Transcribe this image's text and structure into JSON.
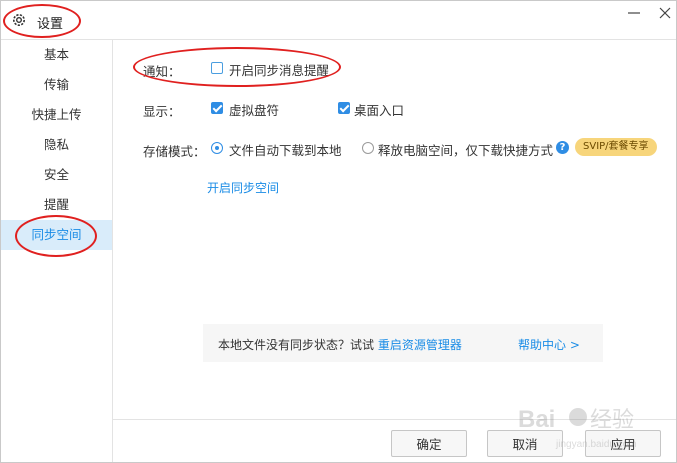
{
  "window": {
    "title": "设置",
    "icons": {
      "settings": "gear-icon",
      "minimize": "minimize-icon",
      "close": "close-icon"
    }
  },
  "sidebar": {
    "items": [
      {
        "label": "基本",
        "active": false
      },
      {
        "label": "传输",
        "active": false
      },
      {
        "label": "快捷上传",
        "active": false
      },
      {
        "label": "隐私",
        "active": false
      },
      {
        "label": "安全",
        "active": false
      },
      {
        "label": "提醒",
        "active": false
      },
      {
        "label": "同步空间",
        "active": true
      }
    ]
  },
  "notify": {
    "label": "通知：",
    "option": "开启同步消息提醒",
    "checked": false
  },
  "display": {
    "label": "显示：",
    "options": [
      {
        "label": "虚拟盘符",
        "checked": true
      },
      {
        "label": "桌面入口",
        "checked": true
      }
    ]
  },
  "storage": {
    "label": "存储模式：",
    "options": [
      {
        "label": "文件自动下载到本地",
        "selected": true
      },
      {
        "label": "释放电脑空间，仅下载快捷方式",
        "selected": false
      }
    ],
    "help_icon": "question-icon",
    "badge": "SVIP/套餐专享"
  },
  "enable_sync_link": "开启同步空间",
  "tip": {
    "text": "本地文件没有同步状态？试试",
    "restart_link": "重启资源管理器",
    "help_link": "帮助中心 >"
  },
  "buttons": {
    "ok": "确定",
    "cancel": "取消",
    "apply": "应用"
  },
  "watermark": {
    "text": "Baidu经验",
    "sub": "jingyan.baidu.com"
  },
  "colors": {
    "accent": "#2f8de4",
    "link": "#1a8ce6",
    "active_item_bg": "#d9ecfa",
    "annotation": "#e0201f",
    "badge_bg": "#f7d57b"
  }
}
